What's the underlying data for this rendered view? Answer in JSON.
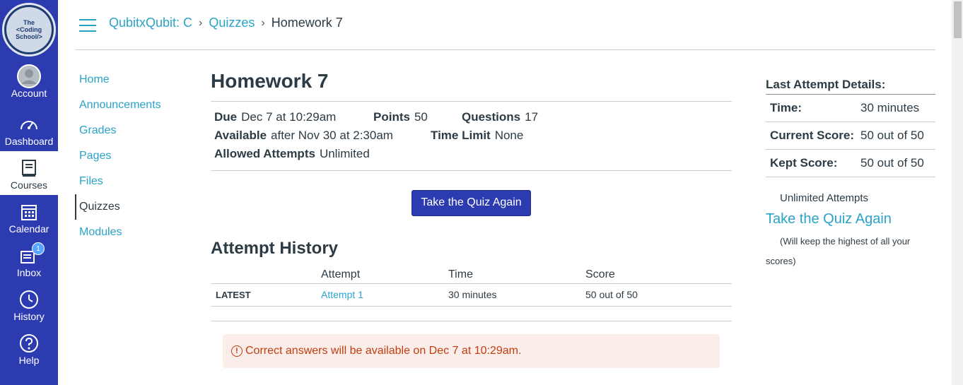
{
  "global_nav": {
    "logo_lines": [
      "The",
      "<Coding",
      "School/>"
    ],
    "items": [
      {
        "label": "Account",
        "icon": "account-avatar-icon"
      },
      {
        "label": "Dashboard",
        "icon": "dashboard-icon"
      },
      {
        "label": "Courses",
        "icon": "courses-icon"
      },
      {
        "label": "Calendar",
        "icon": "calendar-icon"
      },
      {
        "label": "Inbox",
        "icon": "inbox-icon",
        "badge": "1"
      },
      {
        "label": "History",
        "icon": "history-clock-icon"
      },
      {
        "label": "Help",
        "icon": "help-icon"
      }
    ]
  },
  "header": {
    "breadcrumbs": [
      {
        "label": "QubitxQubit: C"
      },
      {
        "label": "Quizzes"
      },
      {
        "label": "Homework 7"
      }
    ]
  },
  "course_nav": {
    "items": [
      "Home",
      "Announcements",
      "Grades",
      "Pages",
      "Files",
      "Quizzes",
      "Modules"
    ],
    "active": "Quizzes"
  },
  "quiz": {
    "title": "Homework 7",
    "due_label": "Due",
    "due_value": "Dec 7 at 10:29am",
    "points_label": "Points",
    "points_value": "50",
    "questions_label": "Questions",
    "questions_value": "17",
    "available_label": "Available",
    "available_value": "after Nov 30 at 2:30am",
    "time_limit_label": "Time Limit",
    "time_limit_value": "None",
    "allowed_attempts_label": "Allowed Attempts",
    "allowed_attempts_value": "Unlimited",
    "take_button": "Take the Quiz Again"
  },
  "attempt_history": {
    "title": "Attempt History",
    "columns": [
      "",
      "Attempt",
      "Time",
      "Score"
    ],
    "rows": [
      {
        "tag": "LATEST",
        "attempt": "Attempt 1",
        "time": "30 minutes",
        "score": "50 out of 50"
      }
    ]
  },
  "notice": {
    "text": "Correct answers will be available on Dec 7 at 10:29am.",
    "color": "#c23c0d"
  },
  "last_attempt": {
    "heading": "Last Attempt Details:",
    "rows": [
      {
        "key": "Time:",
        "value": "30 minutes"
      },
      {
        "key": "Current Score:",
        "value": "50 out of 50"
      },
      {
        "key": "Kept Score:",
        "value": "50 out of 50"
      }
    ],
    "unlimited": "Unlimited Attempts",
    "again_link": "Take the Quiz Again",
    "keep_note": "(Will keep the highest of all your scores)"
  },
  "colors": {
    "nav_bg": "#2d3bb0",
    "link": "#2aa3c9",
    "text": "#2d3b45"
  }
}
